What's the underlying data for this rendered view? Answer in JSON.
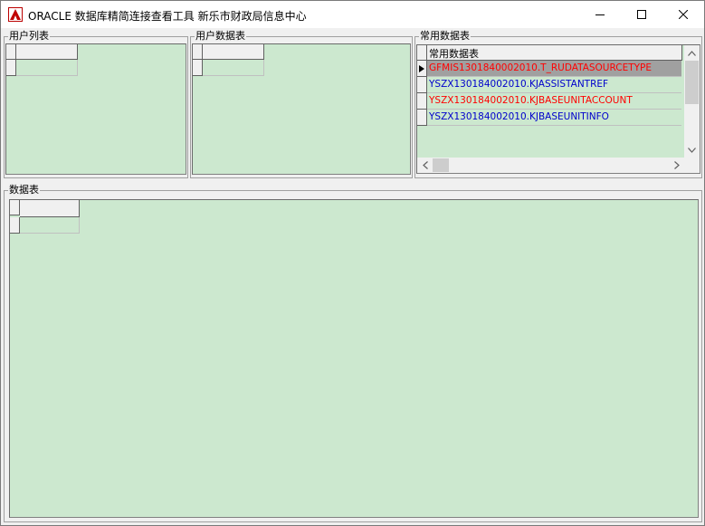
{
  "window": {
    "title": "ORACLE 数据库精简连接查看工具 新乐市财政局信息中心"
  },
  "panels": {
    "user_list": {
      "label": "用户列表"
    },
    "user_tables": {
      "label": "用户数据表"
    },
    "favorite_tables": {
      "label": "常用数据表",
      "column_header": "常用数据表",
      "rows": [
        {
          "text": "GFMIS1301840002010.T_RUDATASOURCETYPE",
          "color": "#ff0000",
          "selected": true
        },
        {
          "text": "YSZX130184002010.KJASSISTANTREF",
          "color": "#0000cc",
          "selected": false
        },
        {
          "text": "YSZX130184002010.KJBASEUNITACCOUNT",
          "color": "#ff0000",
          "selected": false
        },
        {
          "text": "YSZX130184002010.KJBASEUNITINFO",
          "color": "#0000cc",
          "selected": false
        }
      ]
    },
    "data_table": {
      "label": "数据表"
    }
  },
  "colors": {
    "grid_background": "#cce8cf",
    "selected_row": "#a0a0a0",
    "red_text": "#ff0000",
    "blue_text": "#0000cc"
  },
  "icons": {
    "app": "oracle-app-icon",
    "minimize": "minimize-icon",
    "maximize": "maximize-icon",
    "close": "close-icon",
    "row_pointer": "row-pointer-icon",
    "scroll_up": "chevron-up-icon",
    "scroll_down": "chevron-down-icon",
    "scroll_left": "chevron-left-icon",
    "scroll_right": "chevron-right-icon"
  }
}
